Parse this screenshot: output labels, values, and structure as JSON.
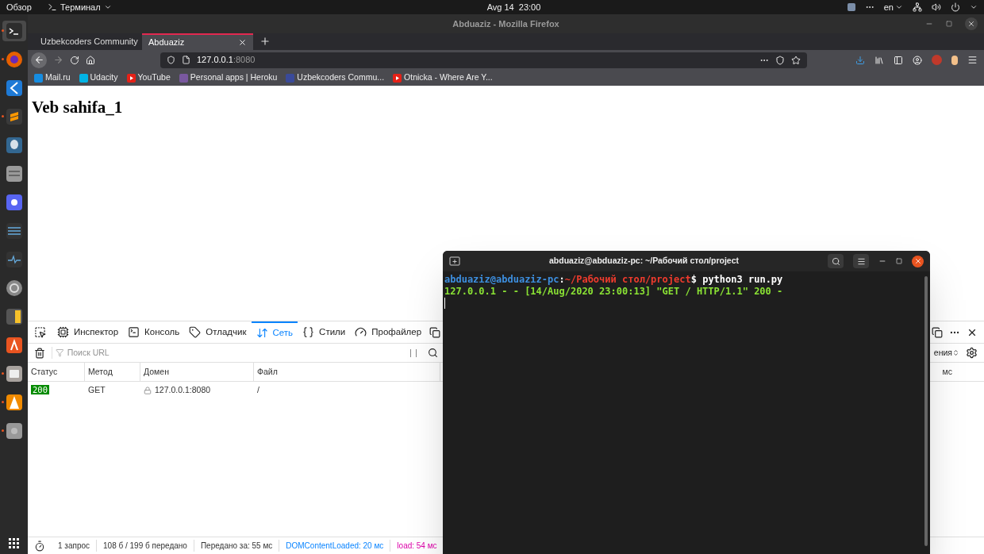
{
  "topbar": {
    "activities": "Обзор",
    "app_menu": "Терминал",
    "clock": "Avg 14  23:00",
    "language": "en"
  },
  "dock": [
    {
      "kind": "terminal",
      "running": true,
      "selected": true
    },
    {
      "kind": "firefox",
      "running": true,
      "selected": false
    },
    {
      "kind": "vscode",
      "running": false,
      "selected": false
    },
    {
      "kind": "sublime",
      "running": true,
      "selected": false
    },
    {
      "kind": "postgres",
      "running": false,
      "selected": false
    },
    {
      "kind": "database",
      "running": false,
      "selected": false
    },
    {
      "kind": "discord",
      "running": false,
      "selected": false
    },
    {
      "kind": "mixer",
      "running": false,
      "selected": false
    },
    {
      "kind": "monitor",
      "running": false,
      "selected": false
    },
    {
      "kind": "disc",
      "running": false,
      "selected": false
    },
    {
      "kind": "calculator",
      "running": false,
      "selected": false
    },
    {
      "kind": "store",
      "running": false,
      "selected": false
    },
    {
      "kind": "files",
      "running": true,
      "selected": false
    },
    {
      "kind": "vlc",
      "running": true,
      "selected": false
    },
    {
      "kind": "drive",
      "running": true,
      "selected": false
    }
  ],
  "browser": {
    "window_title": "Abduaziz - Mozilla Firefox",
    "tabs": [
      {
        "title": "Uzbekcoders Community",
        "selected": false
      },
      {
        "title": "Abduaziz",
        "selected": true
      }
    ],
    "url_host": "127.0.0.1",
    "url_port": ":8080",
    "bookmarks": [
      {
        "kind": "mail",
        "label": "Mail.ru"
      },
      {
        "kind": "udacity",
        "label": "Udacity"
      },
      {
        "kind": "youtube",
        "label": "YouTube"
      },
      {
        "kind": "heroku",
        "label": "Personal apps | Heroku"
      },
      {
        "kind": "uzbek",
        "label": "Uzbekcoders Commu..."
      },
      {
        "kind": "youtube",
        "label": "Otnicka - Where Are Y..."
      }
    ],
    "page": {
      "heading": "Veb sahifa_1"
    }
  },
  "devtools": {
    "tabs": [
      {
        "kind": "inspector",
        "label": "Инспектор",
        "selected": false
      },
      {
        "kind": "console",
        "label": "Консоль",
        "selected": false
      },
      {
        "kind": "debugger",
        "label": "Отладчик",
        "selected": false
      },
      {
        "kind": "network",
        "label": "Сеть",
        "selected": true
      },
      {
        "kind": "styles",
        "label": "Стили",
        "selected": false
      },
      {
        "kind": "profiler",
        "label": "Профайлер",
        "selected": false
      }
    ],
    "filter": {
      "placeholder": "Поиск URL"
    },
    "columns": [
      "Статус",
      "Метод",
      "Домен",
      "Файл"
    ],
    "rows": [
      {
        "status": "200",
        "method": "GET",
        "domain": "127.0.0.1:8080",
        "file": "/"
      }
    ],
    "throttle": "ения",
    "timeline_header": "мс",
    "status_bar": {
      "requests": "1 запрос",
      "transferred": "108 б / 199 б передано",
      "finish": "Передано за: 55 мс",
      "dom_loaded": "DOMContentLoaded: 20 мс",
      "load": "load: 54 мс"
    }
  },
  "terminal": {
    "title": "abduaziz@abduaziz-pc: ~/Рабочий стол/project",
    "prompt": {
      "user_host": "abduaziz@abduaziz-pc",
      "separator": ":",
      "path": "~/Рабочий стол/project",
      "symbol": "$",
      "command": "python3 run.py"
    },
    "output": [
      "127.0.0.1 - - [14/Aug/2020 23:00:13] \"GET / HTTP/1.1\" 200 -"
    ]
  }
}
